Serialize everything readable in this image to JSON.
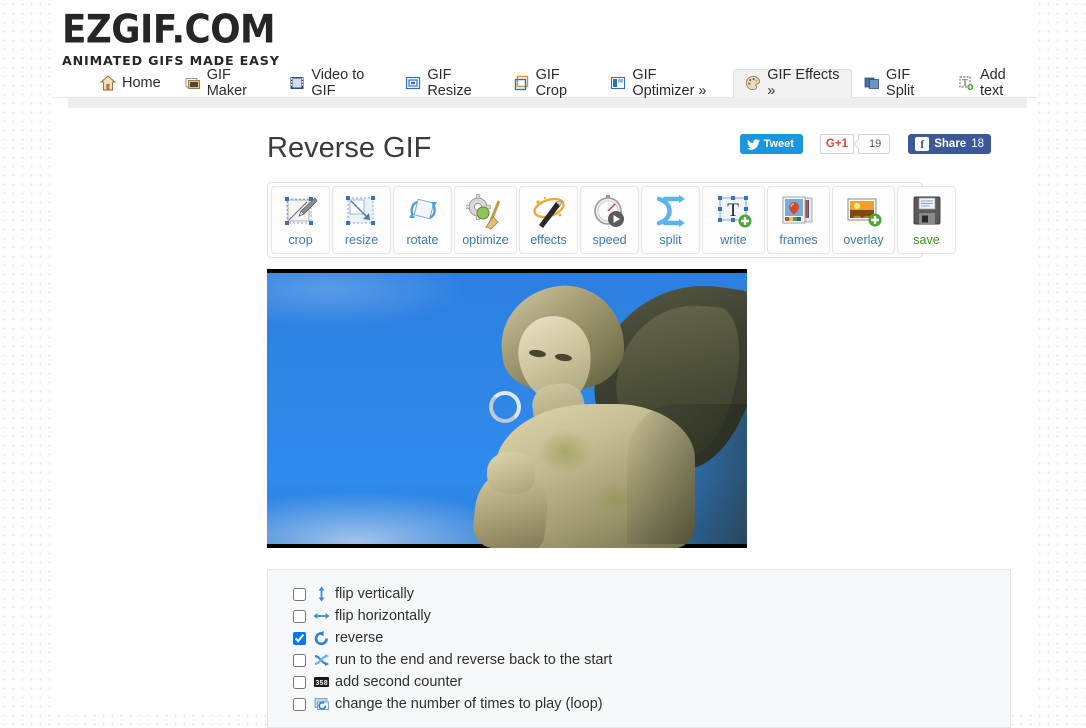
{
  "site": {
    "logo_main": "EZGIF.COM",
    "logo_sub": "ANIMATED GIFS MADE EASY"
  },
  "nav": {
    "items": [
      {
        "label": "Home",
        "icon": "home-icon",
        "active": false
      },
      {
        "label": "GIF Maker",
        "icon": "gif-maker-icon",
        "active": false
      },
      {
        "label": "Video to GIF",
        "icon": "video-to-gif-icon",
        "active": false
      },
      {
        "label": "GIF Resize",
        "icon": "gif-resize-icon",
        "active": false
      },
      {
        "label": "GIF Crop",
        "icon": "gif-crop-icon",
        "active": false
      },
      {
        "label": "GIF Optimizer »",
        "icon": "gif-optimizer-icon",
        "active": false
      },
      {
        "label": "GIF Effects »",
        "icon": "gif-effects-palette-icon",
        "active": true
      },
      {
        "label": "GIF Split",
        "icon": "gif-split-icon",
        "active": false
      },
      {
        "label": "Add text",
        "icon": "add-text-icon",
        "active": false
      }
    ]
  },
  "page": {
    "title": "Reverse GIF"
  },
  "social": {
    "tweet_label": "Tweet",
    "gplus_label": "G+1",
    "gplus_count": "19",
    "fb_share_label": "Share",
    "fb_share_count": "18"
  },
  "tools": [
    {
      "label": "crop",
      "icon": "crop-tool-icon",
      "color": "blue"
    },
    {
      "label": "resize",
      "icon": "resize-tool-icon",
      "color": "blue"
    },
    {
      "label": "rotate",
      "icon": "rotate-tool-icon",
      "color": "blue"
    },
    {
      "label": "optimize",
      "icon": "optimize-tool-icon",
      "color": "blue"
    },
    {
      "label": "effects",
      "icon": "effects-tool-icon",
      "color": "blue"
    },
    {
      "label": "speed",
      "icon": "speed-tool-icon",
      "color": "blue"
    },
    {
      "label": "split",
      "icon": "split-tool-icon",
      "color": "blue"
    },
    {
      "label": "write",
      "icon": "write-tool-icon",
      "color": "blue"
    },
    {
      "label": "frames",
      "icon": "frames-tool-icon",
      "color": "blue"
    },
    {
      "label": "overlay",
      "icon": "overlay-tool-icon",
      "color": "blue"
    },
    {
      "label": "save",
      "icon": "save-tool-icon",
      "color": "green"
    }
  ],
  "preview": {
    "alt": "animated gif preview of a winged angel statue against blue sky",
    "status_icon": "loading-spinner-icon"
  },
  "options": [
    {
      "label": "flip vertically",
      "icon": "flip-vertical-icon",
      "checked": false
    },
    {
      "label": "flip horizontally",
      "icon": "flip-horizontal-icon",
      "checked": false
    },
    {
      "label": "reverse",
      "icon": "reverse-icon",
      "checked": true
    },
    {
      "label": "run to the end and reverse back to the start",
      "icon": "pingpong-icon",
      "checked": false
    },
    {
      "label": "add second counter",
      "icon": "counter-icon",
      "checked": false
    },
    {
      "label": "change the number of times to play (loop)",
      "icon": "loop-icon",
      "checked": false
    }
  ],
  "colors": {
    "accent_blue": "#3e7ab5",
    "save_green": "#3f8f28",
    "twitter": "#1b95e0",
    "facebook": "#3b5998",
    "gplus_red": "#dd4b39",
    "sky": "#2f86e6"
  }
}
